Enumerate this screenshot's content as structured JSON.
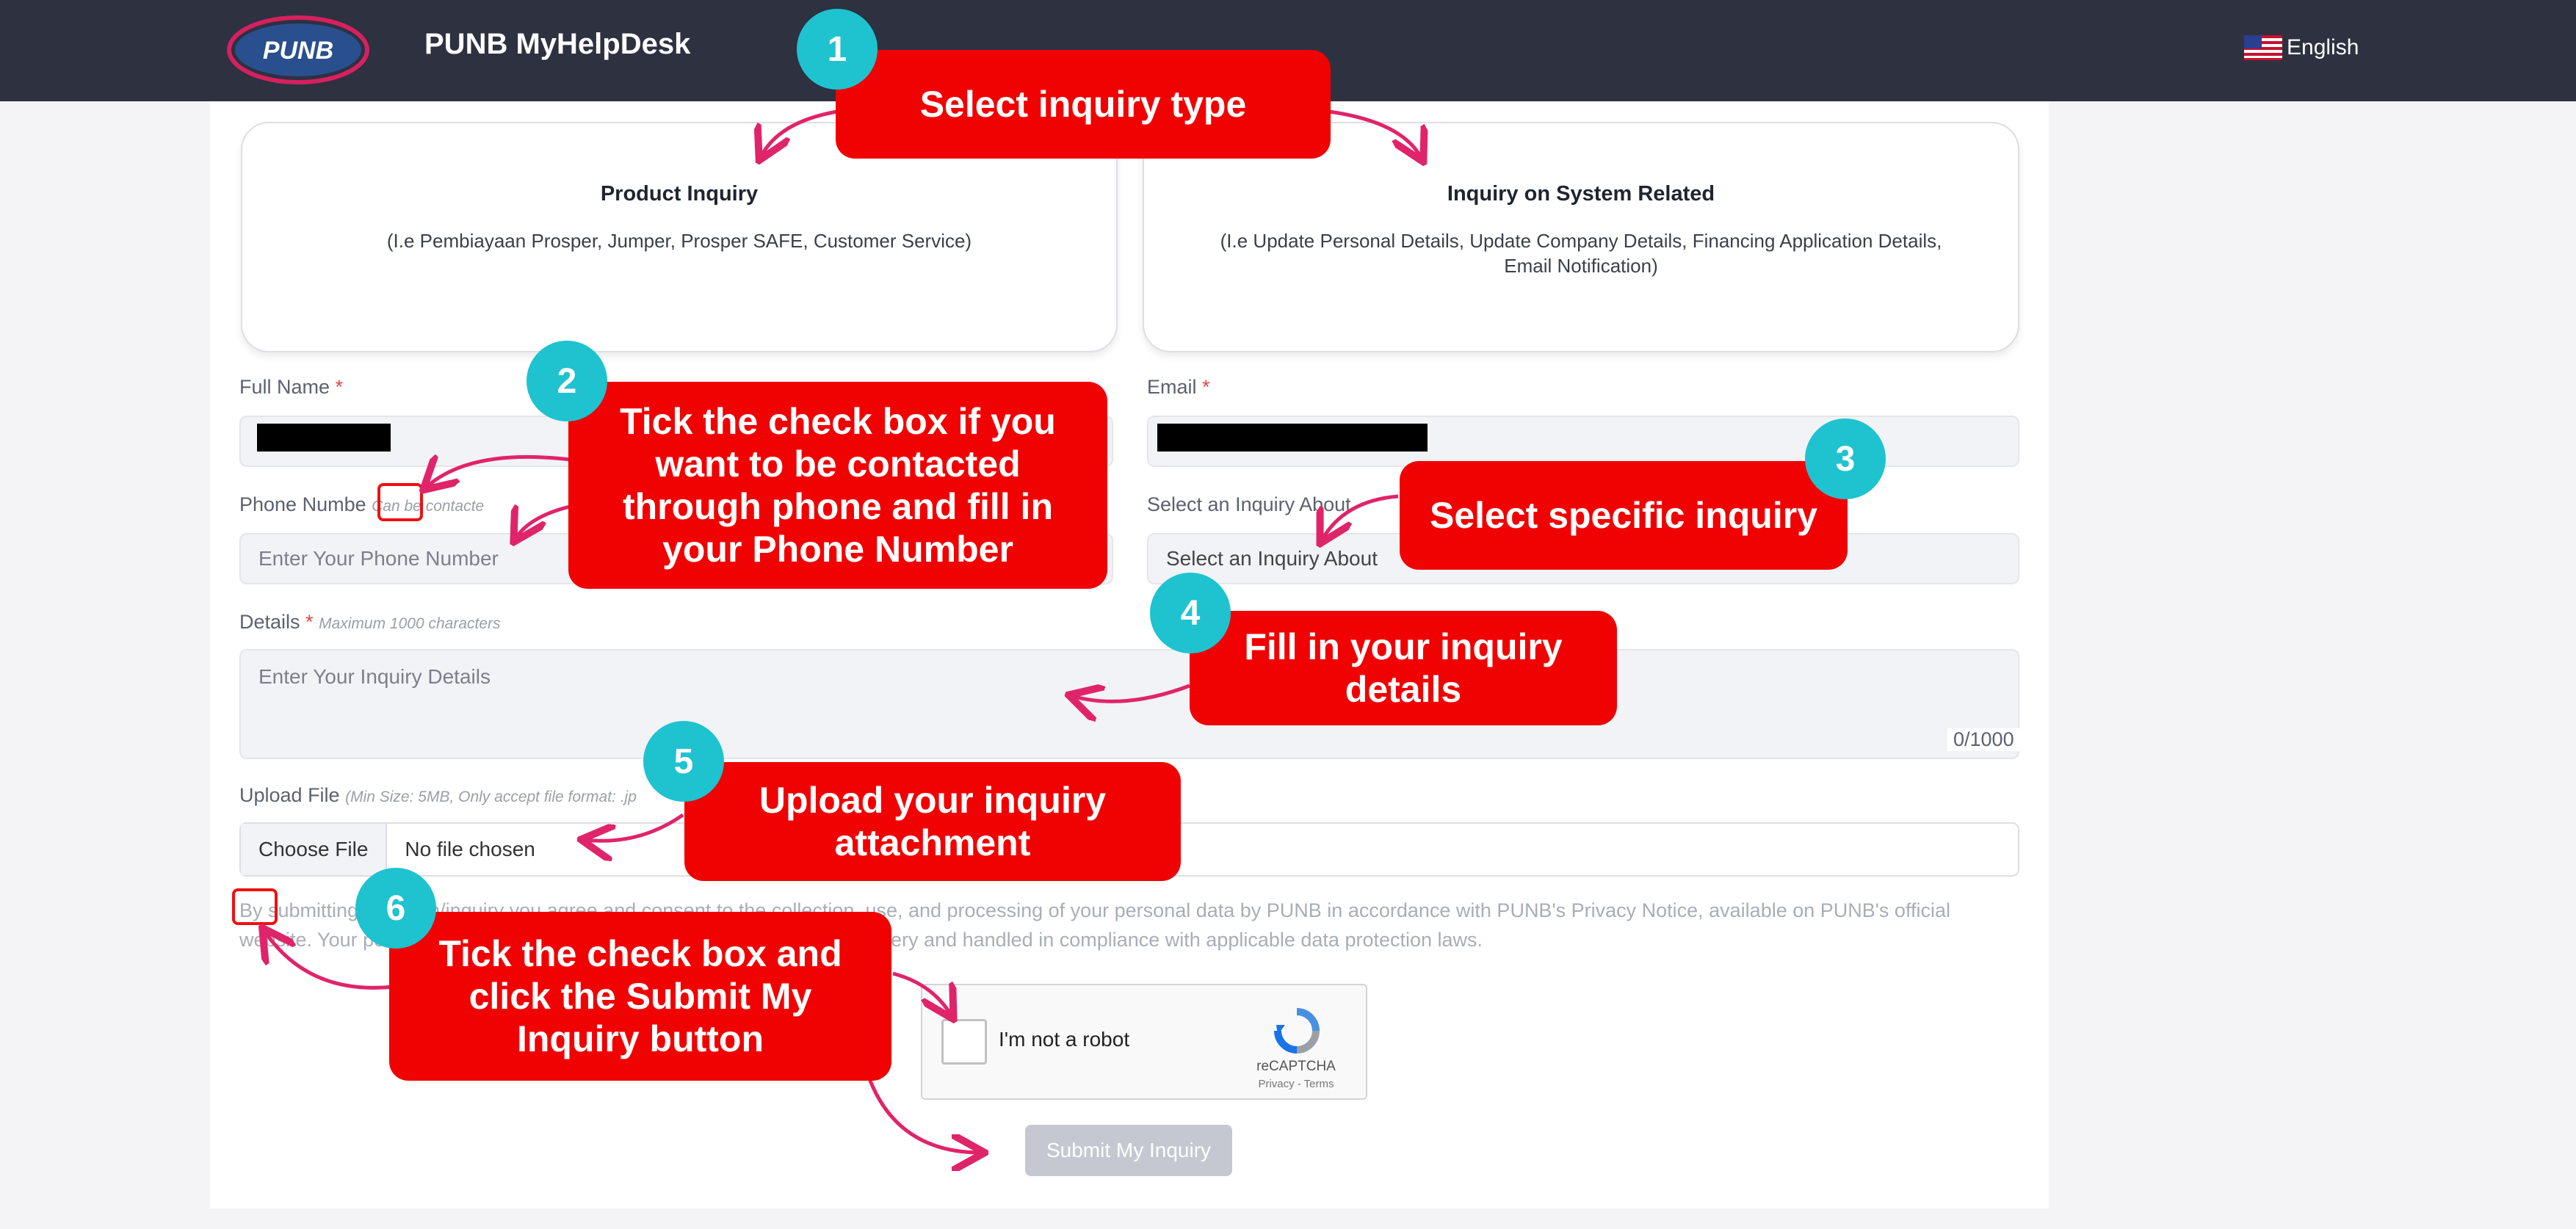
{
  "header": {
    "app_title": "PUNB MyHelpDesk",
    "language": "English",
    "logo_text": "PUNB"
  },
  "inquiry_types": [
    {
      "title": "Product Inquiry",
      "desc": "(I.e Pembiayaan Prosper, Jumper, Prosper SAFE, Customer Service)"
    },
    {
      "title": "Inquiry on System Related",
      "desc": "(I.e Update Personal Details, Update Company Details, Financing Application Details, Email Notification)"
    }
  ],
  "form": {
    "full_name_label": "Full Name",
    "email_label": "Email",
    "phone_label": "Phone Numbe",
    "phone_hint": "Can be contacte",
    "phone_placeholder": "Enter Your Phone Number",
    "inquiry_about_label": "Select an Inquiry About",
    "inquiry_about_value": "Select an Inquiry About",
    "details_label": "Details",
    "details_hint": "Maximum 1000 characters",
    "details_placeholder": "Enter Your Inquiry Details",
    "details_counter": "0/1000",
    "upload_label": "Upload File",
    "upload_hint": "(Min Size: 5MB, Only accept file format: .jp",
    "choose_file": "Choose File",
    "no_file": "No file chosen",
    "consent_text": "By submitting this form/inquiry you agree and consent to the collection, use, and processing of your personal data by PUNB in accordance with PUNB's Privacy Notice, available on PUNB's official website. Your personal data will be used solely for the purposes of your query and handled in compliance with applicable data protection laws.",
    "required_mark": "*",
    "submit_label": "Submit My Inquiry"
  },
  "captcha": {
    "label": "I'm not a robot",
    "brand": "reCAPTCHA",
    "links": "Privacy - Terms"
  },
  "callouts": {
    "c1": "Select inquiry type",
    "c2_plain": "Tick the check box if you want to be contacted through phone and fill in your",
    "c2_bold": "Phone Number",
    "c3": "Select specific inquiry",
    "c4": "Fill in your inquiry details",
    "c5": "Upload your inquiry attachment",
    "c6": "Tick the check box and click the Submit My Inquiry button"
  },
  "badges": [
    "1",
    "2",
    "3",
    "4",
    "5",
    "6"
  ],
  "colors": {
    "header": "#2d3140",
    "callout": "#f00202",
    "badge": "#1ec3cf",
    "arrow": "#e0246a"
  }
}
